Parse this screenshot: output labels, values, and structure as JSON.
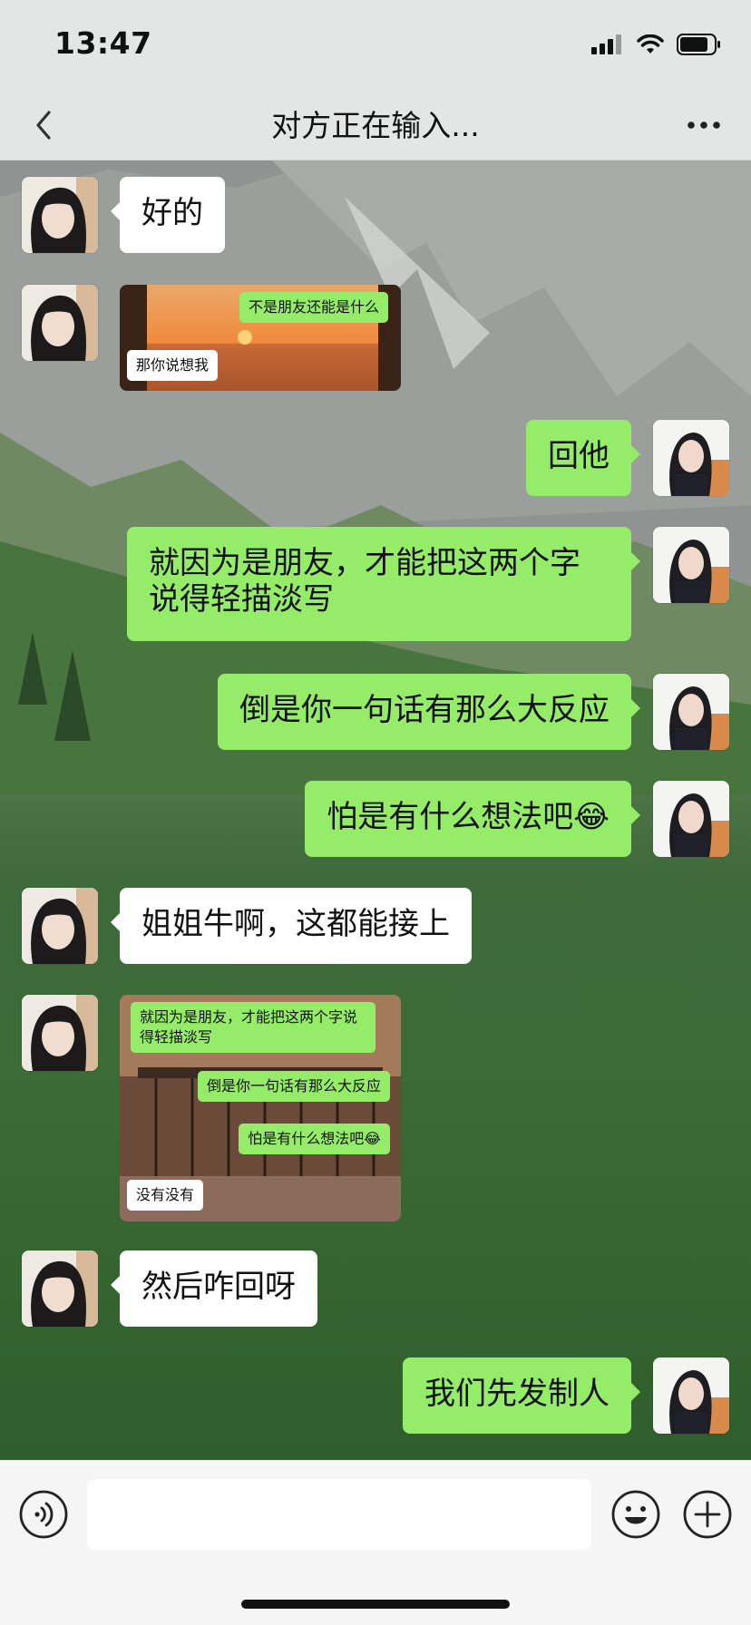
{
  "status": {
    "time": "13:47"
  },
  "nav": {
    "title": "对方正在输入..."
  },
  "messages": {
    "m1": "好的",
    "m3": "回他",
    "m4": "就因为是朋友，才能把这两个字说得轻描淡写",
    "m5": "倒是你一句话有那么大反应",
    "m6": "怕是有什么想法吧😂",
    "m7": "姐姐牛啊，这都能接上",
    "m9": "然后咋回呀",
    "m10": "我们先发制人"
  },
  "screenshot1": {
    "green": "不是朋友还能是什么",
    "white": "那你说想我"
  },
  "screenshot2": {
    "g1": "就因为是朋友，才能把这两个字说得轻描淡写",
    "g2": "倒是你一句话有那么大反应",
    "g3": "怕是有什么想法吧😂",
    "white": "没有没有"
  },
  "icons": [
    "back-arrow-icon",
    "more-dots-icon",
    "voice-icon",
    "emoji-icon",
    "plus-icon",
    "signal-icon",
    "wifi-icon",
    "battery-icon"
  ],
  "colors": {
    "bubble_right": "#95ec69",
    "bubble_left": "#ffffff",
    "bar": "#e4e6e5"
  }
}
